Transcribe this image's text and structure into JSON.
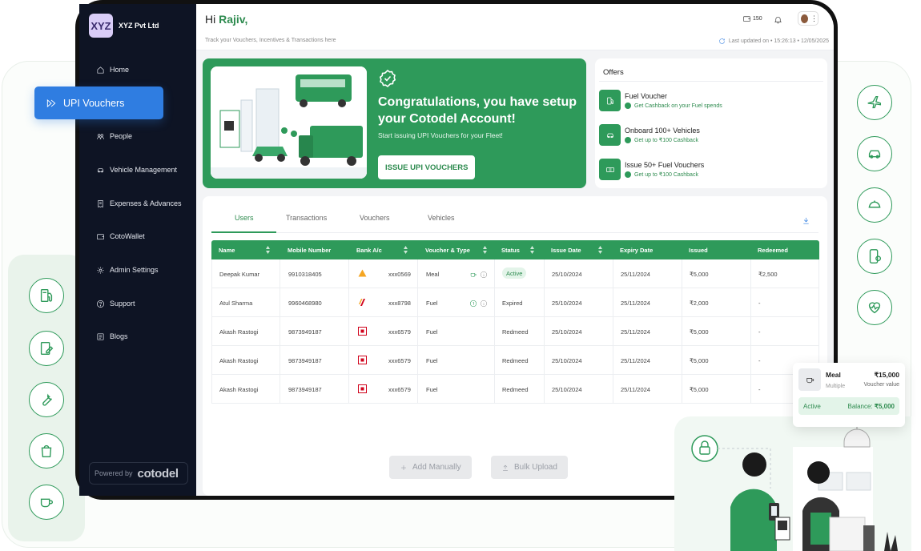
{
  "company": {
    "logo_text": "XYZ",
    "name": "XYZ Pvt Ltd"
  },
  "floating_pill": {
    "label": "UPI Vouchers"
  },
  "sidebar": {
    "items": [
      {
        "label": "Home",
        "icon": "home-icon"
      },
      {
        "label": "People",
        "icon": "people-icon"
      },
      {
        "label": "Vehicle Management",
        "icon": "car-icon"
      },
      {
        "label": "Expenses & Advances",
        "icon": "receipt-icon"
      },
      {
        "label": "CotoWallet",
        "icon": "wallet-icon"
      },
      {
        "label": "Admin Settings",
        "icon": "gear-icon"
      },
      {
        "label": "Support",
        "icon": "help-icon"
      },
      {
        "label": "Blogs",
        "icon": "blog-icon"
      }
    ],
    "powered_by": "Powered by",
    "brand": "cotodel"
  },
  "header": {
    "greeting": "Hi",
    "user_name": "Rajiv,",
    "tagline": "Track your Vouchers, Incentives & Transactions here",
    "last_updated": "Last updated on  •  15:26:13  •  12/05/2025",
    "wallet_count": "150",
    "menu_dots": "⋮"
  },
  "banner": {
    "title": "Congratulations, you have setup your Cotodel Account!",
    "subtitle": "Start issuing UPI Vouchers for your Fleet!",
    "button": "ISSUE UPI VOUCHERS"
  },
  "offers": {
    "title": "Offers",
    "items": [
      {
        "name": "Fuel Voucher",
        "sub": "Get Cashback on your Fuel spends"
      },
      {
        "name": "Onboard 100+ Vehicles",
        "sub": "Get up to ₹100 Cashback"
      },
      {
        "name": "Issue 50+ Fuel Vouchers",
        "sub": "Get up to ₹100 Cashback"
      }
    ]
  },
  "tabs": [
    "Users",
    "Transactions",
    "Vouchers",
    "Vehicles"
  ],
  "table": {
    "columns": [
      "Name",
      "Mobile Number",
      "Bank A/c",
      "Voucher & Type",
      "Status",
      "Issue Date",
      "Expiry Date",
      "Issued",
      "Redeemed"
    ],
    "rows": [
      {
        "name": "Deepak Kumar",
        "mobile": "9910318405",
        "bank": "xxx0569",
        "type": "Meal",
        "status": "Active",
        "issue": "25/10/2024",
        "expiry": "25/11/2024",
        "issued": "₹5,000",
        "redeemed": "₹2,500"
      },
      {
        "name": "Atul Sharma",
        "mobile": "9960468980",
        "bank": "xxx8798",
        "type": "Fuel",
        "status": "Expired",
        "issue": "25/10/2024",
        "expiry": "25/11/2024",
        "issued": "₹2,000",
        "redeemed": "-"
      },
      {
        "name": "Akash Rastogi",
        "mobile": "9873949187",
        "bank": "xxx6579",
        "type": "Fuel",
        "status": "Redmeed",
        "issue": "25/10/2024",
        "expiry": "25/11/2024",
        "issued": "₹5,000",
        "redeemed": "-"
      },
      {
        "name": "Akash Rastogi",
        "mobile": "9873949187",
        "bank": "xxx6579",
        "type": "Fuel",
        "status": "Redmeed",
        "issue": "25/10/2024",
        "expiry": "25/11/2024",
        "issued": "₹5,000",
        "redeemed": "-"
      },
      {
        "name": "Akash Rastogi",
        "mobile": "9873949187",
        "bank": "xxx6579",
        "type": "Fuel",
        "status": "Redmeed",
        "issue": "25/10/2024",
        "expiry": "25/11/2024",
        "issued": "₹5,000",
        "redeemed": "-"
      }
    ]
  },
  "actions": {
    "add_manually": "Add Manually",
    "bulk_upload": "Bulk Upload"
  },
  "meal_card": {
    "name": "Meal",
    "sub": "Multiple",
    "amount": "₹15,000",
    "value_label": "Voucher value",
    "status": "Active",
    "balance_label": "Balance:",
    "balance": "₹5,000"
  },
  "colors": {
    "brand_green": "#2e9a5a",
    "sidebar_bg": "#0e1424",
    "accent_blue": "#2f7de1"
  }
}
